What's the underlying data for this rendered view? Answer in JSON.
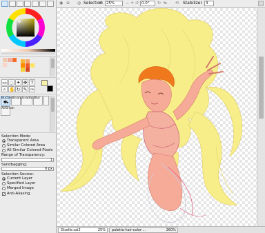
{
  "toolbar": {
    "selection_label": "Selection",
    "zoom_value": "25%",
    "angle_value": "0.0°",
    "stabilizer_label": "Stabilizer",
    "stabilizer_value": "3"
  },
  "left_panel": {
    "color_modes": [
      "wheel",
      "rgb",
      "hsv",
      "hsl",
      "sw",
      "mix",
      "scratch"
    ],
    "tool_tabs": [
      "Bucket",
      "Binary",
      "Gradati..",
      "Blur"
    ],
    "airbrush_label": "AirBrush",
    "selection_mode_title": "Selection Mode:",
    "selection_modes": [
      "Transparent Area",
      "Similar Colored Area",
      "All Similar Colored Pixels"
    ],
    "selection_mode_selected": 0,
    "range_label": "Range of Transparency:",
    "range_value": "1",
    "sandbagging_label": "Sandbagging:",
    "sandbagging_value": "0 px",
    "selection_source_title": "Selection Source:",
    "selection_sources": [
      "Current Layer",
      "Specified Layer",
      "Merged Image"
    ],
    "selection_source_selected": 0,
    "anti_alias_label": "Anti-Aliasing",
    "anti_alias_checked": true,
    "swatches": [
      "#f0c9b0",
      "#ffffff",
      "#d9d9d9",
      "#f3a46a",
      "#f6b63e",
      "#f4ab9b",
      "#f26b2a",
      "#ff8c00",
      "#e06020",
      "#f0b090",
      "#fcd4c6",
      "#f4d23a",
      "#ffe45c",
      "#f05a28",
      "#d84a20"
    ],
    "primary_color": "#f7f2a8",
    "secondary_color": "#000000",
    "hue_ring_center_color": "#7a6a00"
  },
  "tabs": [
    {
      "label": "Giselle.sai2",
      "zoom": "25%"
    },
    {
      "label": "paletta-hair-color-...",
      "zoom": "260%"
    }
  ],
  "colors": {
    "hair": "#f7ee8a",
    "hair_dark": "#e7d86a",
    "skin": "#f6aa98",
    "outfit": "#f5b1a0",
    "outfit_line": "#c55a73",
    "bang_orange": "#f0781d"
  }
}
